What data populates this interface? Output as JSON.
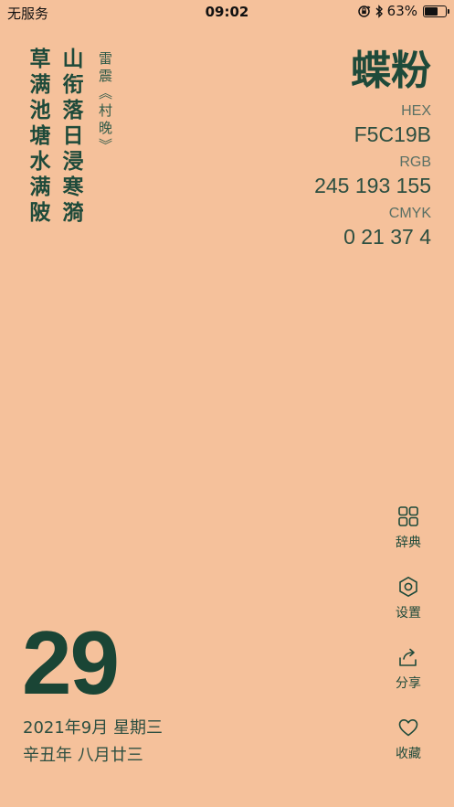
{
  "status": {
    "carrier": "无服务",
    "time": "09:02",
    "battery_text": "63%",
    "battery_level": 0.63
  },
  "poem": {
    "lines": [
      "山衔落日浸寒漪",
      "草满池塘水满陂"
    ],
    "author": "雷震",
    "title": "《村晚》"
  },
  "color": {
    "name": "蝶粉",
    "hex_label": "HEX",
    "hex_value": "F5C19B",
    "rgb_label": "RGB",
    "rgb_value": "245 193 155",
    "cmyk_label": "CMYK",
    "cmyk_value": "0 21 37 4",
    "background": "#F5C19B",
    "text_color": "#1E4A3A"
  },
  "actions": [
    {
      "label": "辞典",
      "icon": "grid-icon"
    },
    {
      "label": "设置",
      "icon": "settings-icon"
    },
    {
      "label": "分享",
      "icon": "share-icon"
    },
    {
      "label": "收藏",
      "icon": "heart-icon"
    }
  ],
  "date": {
    "day": "29",
    "gregorian": "2021年9月  星期三",
    "lunar": "辛丑年  八月廿三"
  }
}
